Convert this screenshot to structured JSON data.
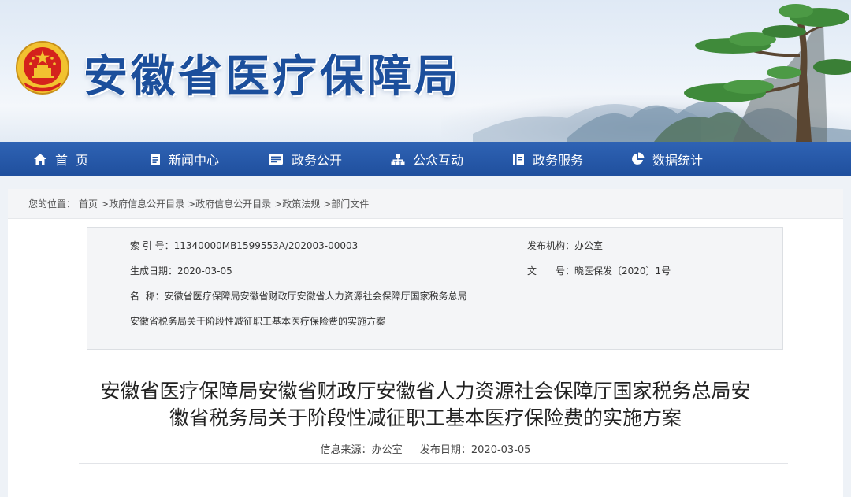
{
  "site": {
    "title": "安徽省医疗保障局"
  },
  "nav": {
    "items": [
      {
        "label": "首  页",
        "icon": "home-icon"
      },
      {
        "label": "新闻中心",
        "icon": "document-icon"
      },
      {
        "label": "政务公开",
        "icon": "list-card-icon"
      },
      {
        "label": "公众互动",
        "icon": "network-icon"
      },
      {
        "label": "政务服务",
        "icon": "book-icon"
      },
      {
        "label": "数据统计",
        "icon": "pie-chart-icon"
      }
    ]
  },
  "breadcrumb": {
    "prefix": "您的位置：",
    "items": [
      "首页",
      ">政府信息公开目录",
      ">政府信息公开目录",
      ">政策法规",
      ">部门文件"
    ]
  },
  "meta": {
    "index_label": "索 引 号：",
    "index_value": "11340000MB1599553A/202003-00003",
    "publisher_label": "发布机构：",
    "publisher_value": "办公室",
    "date_label": "生成日期：",
    "date_value": "2020-03-05",
    "docno_label": "文　　号：",
    "docno_value": "晓医保发〔2020〕1号",
    "name_label": "名  称：",
    "name_line1": "安徽省医疗保障局安徽省财政厅安徽省人力资源社会保障厅国家税务总局",
    "name_line2": "安徽省税务局关于阶段性减征职工基本医疗保险费的实施方案"
  },
  "article": {
    "title_line1": "安徽省医疗保障局安徽省财政厅安徽省人力资源社会保障厅国家税务总局安",
    "title_line2": "徽省税务局关于阶段性减征职工基本医疗保险费的实施方案",
    "source_label": "信息来源：",
    "source_value": "办公室",
    "date_label": "发布日期：",
    "date_value": "2020-03-05"
  },
  "colors": {
    "brand": "#1c4f9c",
    "nav_bg": "#2356a6",
    "emblem_red": "#d4221c",
    "emblem_gold": "#f2c230"
  }
}
